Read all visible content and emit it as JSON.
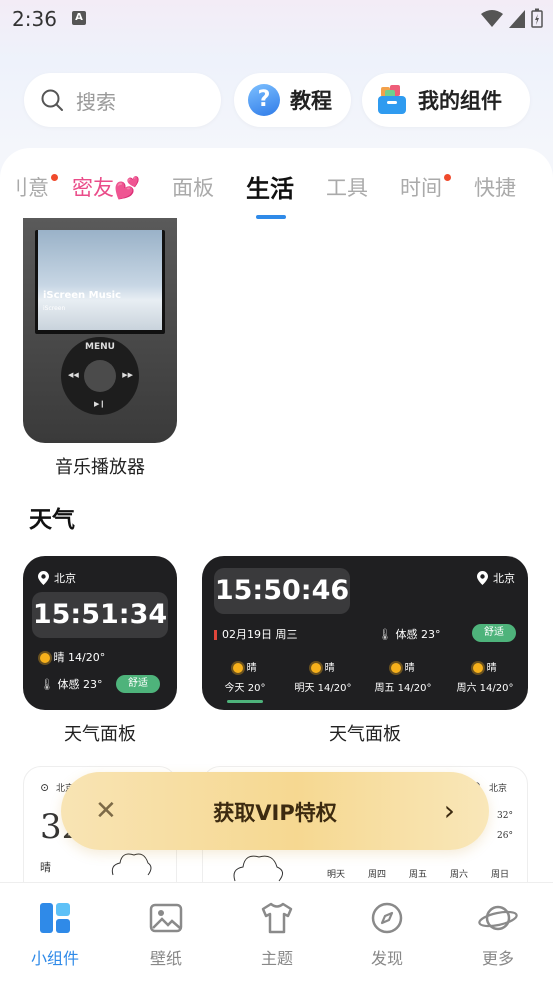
{
  "status_bar": {
    "time": "2:36",
    "badge": "A"
  },
  "top": {
    "search_placeholder": "搜索",
    "tutorial_label": "教程",
    "tutorial_icon": "?",
    "my_widgets_label": "我的组件"
  },
  "tabs": [
    {
      "label": "刂意",
      "dot": true
    },
    {
      "label": "密友💕",
      "dot": false
    },
    {
      "label": "面板",
      "dot": false
    },
    {
      "label": "生活",
      "dot": false
    },
    {
      "label": "工具",
      "dot": false
    },
    {
      "label": "时间",
      "dot": true
    },
    {
      "label": "快捷",
      "dot": false
    }
  ],
  "music_widget": {
    "screen_title": "iScreen Music",
    "screen_sub": "iScreen",
    "menu": "MENU",
    "caption": "音乐播放器"
  },
  "section_title": "天气",
  "weather_small": {
    "city": "北京",
    "time": "15:51:34",
    "condition": "晴 14/20°",
    "feel": "体感 23°",
    "comfort": "舒适",
    "caption": "天气面板"
  },
  "weather_large": {
    "city": "北京",
    "time": "15:50:46",
    "date": "02月19日 周三",
    "feel": "体感 23°",
    "comfort": "舒适",
    "days": [
      {
        "cond": "晴",
        "label": "今天 20°"
      },
      {
        "cond": "晴",
        "label": "明天 14/20°"
      },
      {
        "cond": "晴",
        "label": "周五 14/20°"
      },
      {
        "cond": "晴",
        "label": "周六 14/20°"
      }
    ],
    "caption": "天气面板"
  },
  "handwriting_small": {
    "city": "北京",
    "temp": "32",
    "cond": "晴"
  },
  "handwriting_large": {
    "city": "北京",
    "hi": "32°",
    "lo": "26°",
    "days": [
      "明天",
      "周四",
      "周五",
      "周六",
      "周日"
    ]
  },
  "vip_banner": {
    "label": "获取VIP特权"
  },
  "bottom_nav": [
    {
      "label": "小组件",
      "active": true
    },
    {
      "label": "壁纸",
      "active": false
    },
    {
      "label": "主题",
      "active": false
    },
    {
      "label": "发现",
      "active": false
    },
    {
      "label": "更多",
      "active": false
    }
  ],
  "colors": {
    "accent": "#2f8ae8",
    "comfort": "#4eb37b",
    "pink": "#ea4c89"
  }
}
